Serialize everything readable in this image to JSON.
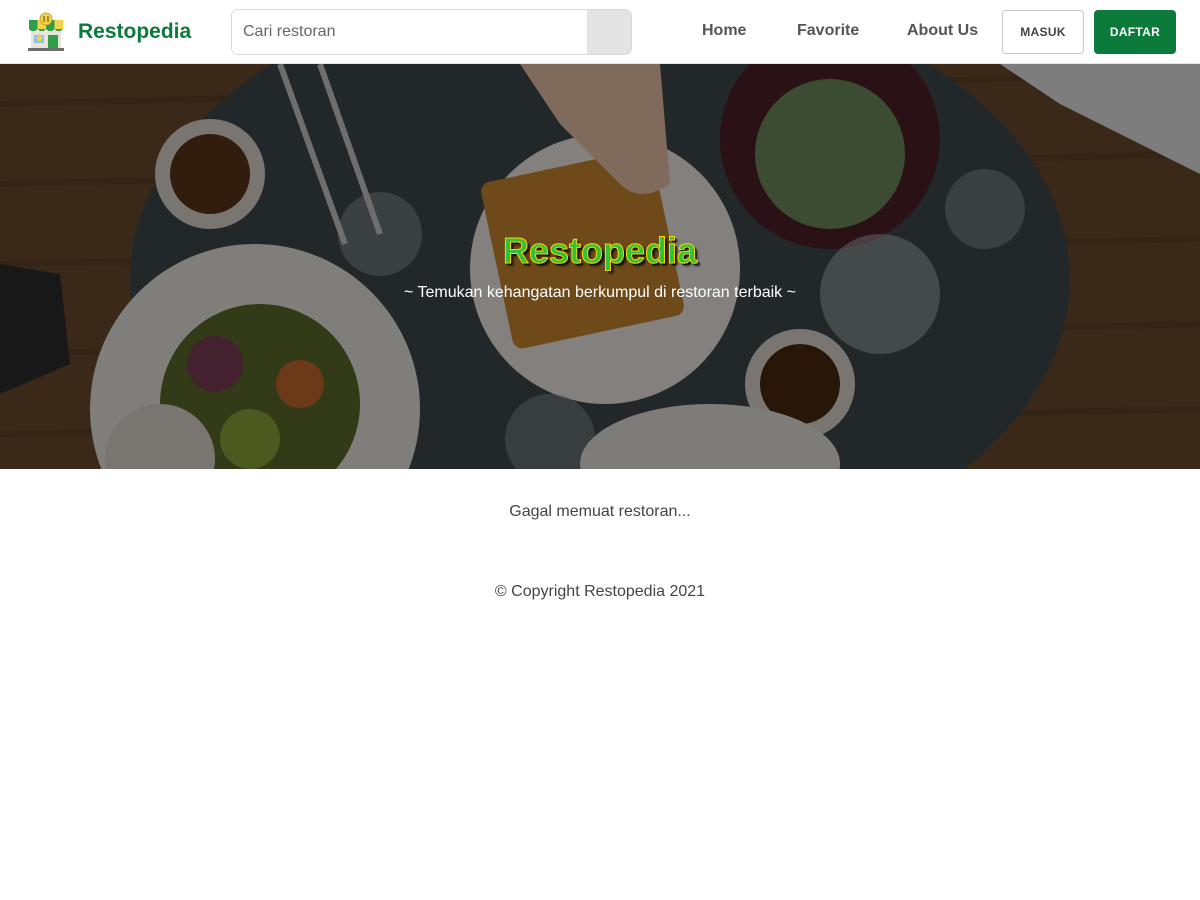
{
  "header": {
    "brand_name": "Restopedia",
    "logo_icon": "store-icon",
    "search": {
      "placeholder": "Cari restoran",
      "value": "",
      "button_icon": "search-icon"
    },
    "nav": [
      {
        "label": "Home"
      },
      {
        "label": "Favorite"
      },
      {
        "label": "About Us"
      }
    ],
    "login_label": "MASUK",
    "register_label": "DAFTAR"
  },
  "hero": {
    "title": "Restopedia",
    "tagline": "~ Temukan kehangatan berkumpul di restoran terbaik ~",
    "background": "dining-table-photo"
  },
  "main": {
    "status_text": "Gagal memuat restoran..."
  },
  "footer": {
    "copyright": "© Copyright Restopedia 2021"
  },
  "colors": {
    "brand_green": "#0b7a3b",
    "hero_title_green": "#2fc23a",
    "hero_title_outline": "#ffd600",
    "search_button_bg": "#e4e4e5"
  }
}
